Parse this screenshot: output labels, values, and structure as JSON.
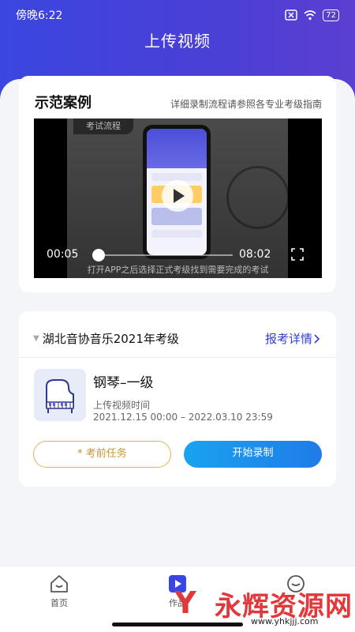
{
  "status": {
    "time": "傍晚6:22",
    "battery": "72"
  },
  "header": {
    "title": "上传视频"
  },
  "demo": {
    "title": "示范案例",
    "guide": "详细录制流程请参照各专业考级指南",
    "video": {
      "tag": "考试流程",
      "current_time": "00:05",
      "duration": "08:02",
      "progress": 0.01,
      "caption": "打开APP之后选择正式考级找到需要完成的考试"
    }
  },
  "exam": {
    "name": "湖北音协音乐2021年考级",
    "detail_label": "报考详情",
    "subject": "钢琴–一级",
    "upload_label": "上传视频时间",
    "upload_range": "2021.12.15 00:00 – 2022.03.10 23:59",
    "task_button": "* 考前任务",
    "record_button": "开始录制"
  },
  "tabbar": {
    "home": "首页",
    "upload": "作品",
    "mine": ""
  },
  "watermark": {
    "text": "永辉资源网",
    "url": "www.yhkjjj.com"
  },
  "colors": {
    "primary": "#3b46e0",
    "accent_blue": "#1f7be8",
    "task_gold": "#e2b25a",
    "link": "#3340c8"
  }
}
